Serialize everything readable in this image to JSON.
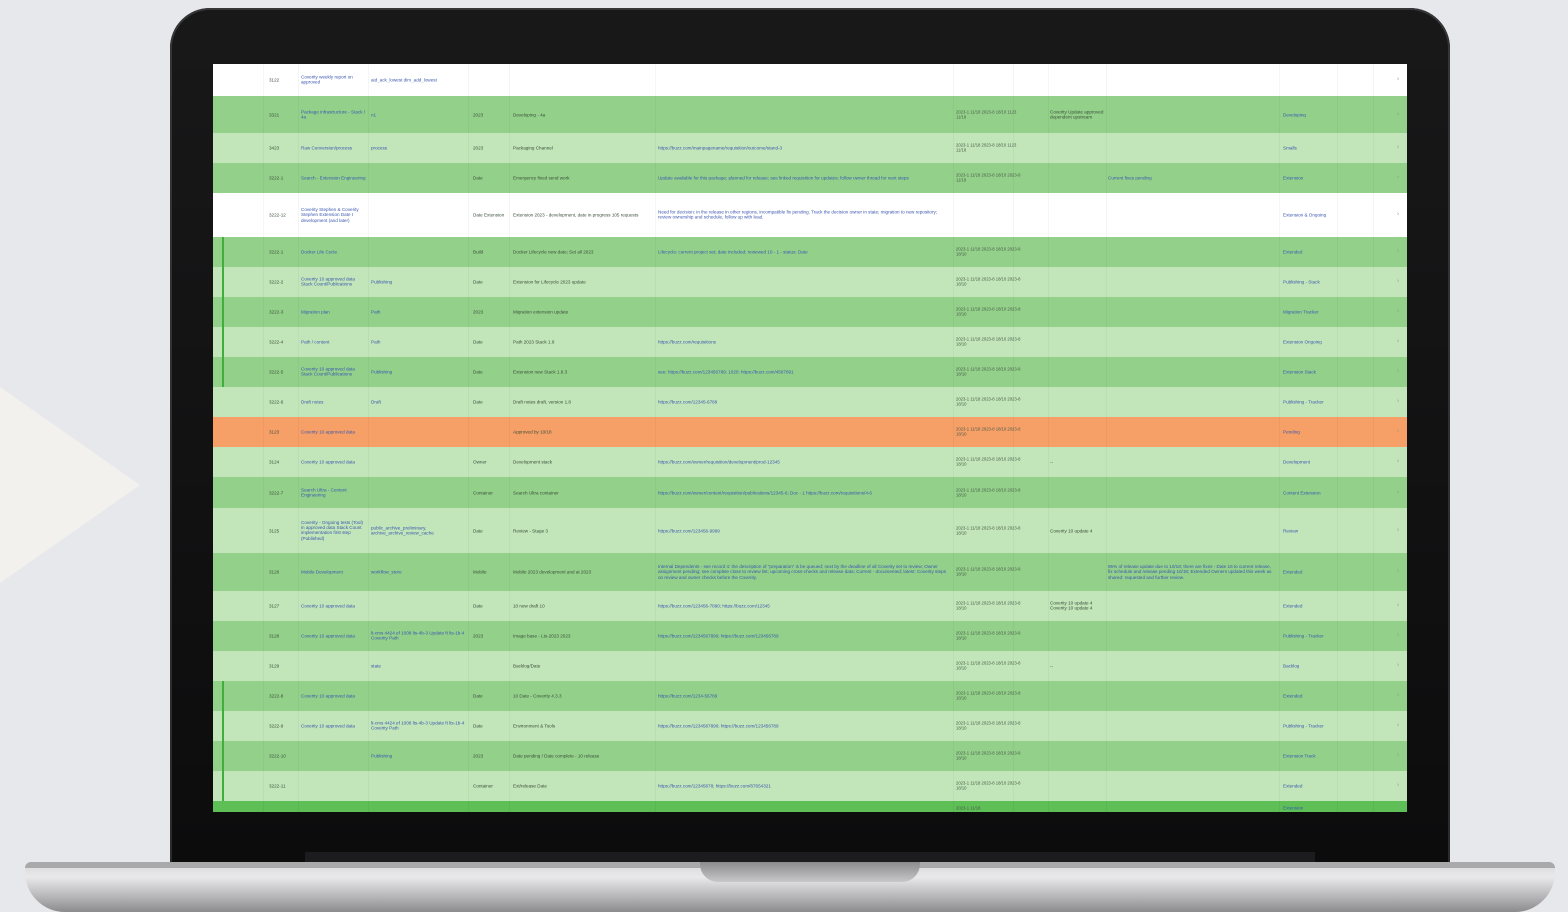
{
  "device": {
    "type": "laptop"
  },
  "sheet": {
    "rows": [
      {
        "style": "white",
        "h": 32,
        "mark": false,
        "cells": {
          "id": "3122",
          "title": "Coverity weekly report on approved",
          "tag": "aid_ack_lowest dim_add_lowest",
          "status": "",
          "summary": "",
          "note": "",
          "dates": "",
          "comment": "",
          "extra": "",
          "owner": ""
        }
      },
      {
        "style": "gd",
        "h": 37,
        "mark": false,
        "cells": {
          "id": "3321",
          "title": "Package infrastructure - Stack / 4a",
          "tag": "n1",
          "status": "2023",
          "summary": "Developing - 4a",
          "note": "",
          "dates": "2023-1 11/18 2023-8 18/10 1123 11/18",
          "comment": "Coverity Update approved dependent upstream",
          "extra": "",
          "owner": "Developing"
        }
      },
      {
        "style": "gl",
        "h": 30,
        "mark": false,
        "cells": {
          "id": "3423",
          "title": "Raw Conversion/process",
          "tag": "process",
          "status": "2023",
          "summary": "Packaging Channel",
          "note": "https://buzz.com/mainpagename/requisition/outcome/stand-3",
          "dates": "2023-1 11/18 2023-8 18/10 1123 11/18",
          "comment": "",
          "extra": "",
          "owner": "Smalls"
        }
      },
      {
        "style": "gd",
        "h": 30,
        "mark": false,
        "cells": {
          "id": "3222-1",
          "title": "Search - Extension Engineering",
          "tag": "",
          "status": "Date",
          "summary": "Emergency fixed send work",
          "note": "Update available for this package; planned for release; see linked requisition for updates; follow owner thread for next steps",
          "dates": "2023-1 11/18 2023-8 18/10 2023-8 11/18",
          "comment": "",
          "extra": "Current fixes pending",
          "owner": "Extension"
        }
      },
      {
        "style": "white",
        "h": 44,
        "mark": false,
        "cells": {
          "id": "3222-12",
          "title": "Coverity Stephen & Coverity Stephen Extension Date I development (and later)",
          "tag": "",
          "status": "Date Extension",
          "summary": "Extension 2023 - development, date in progress 105 requests",
          "note": "Need for decision: in the release in other regions, incompatible fix pending. Track the decision owner in state; migration to new repository; review ownership and schedule, follow up with lead.",
          "dates": "",
          "comment": "",
          "extra": "",
          "owner": "Extension & Ongoing"
        }
      },
      {
        "style": "gd",
        "h": 30,
        "mark": true,
        "cells": {
          "id": "3222-1",
          "title": "Docker Life Cycle",
          "tag": "",
          "status": "Build",
          "summary": "Docker Lifecycle new date; Set all 2023",
          "note": "Lifecycle: current project set; date included; reviewed 10 - 1 - status: Date",
          "dates": "2023-1 11/18 2023-8 18/10 2023-8 18/10",
          "comment": "",
          "extra": "",
          "owner": "Extended"
        }
      },
      {
        "style": "gl",
        "h": 30,
        "mark": true,
        "cells": {
          "id": "3222-2",
          "title": "Coverity 10 approved data Stack Count/Publications",
          "tag": "Publishing",
          "status": "Date",
          "summary": "Extension for Lifecycle 2023 update",
          "note": "",
          "dates": "2023-1 11/18 2023-8 18/10 2023-8 18/10",
          "comment": "",
          "extra": "",
          "owner": "Publishing - Stack"
        }
      },
      {
        "style": "gd",
        "h": 30,
        "mark": true,
        "cells": {
          "id": "3222-3",
          "title": "Migration plan",
          "tag": "Path",
          "status": "2023",
          "summary": "Migration extension update",
          "note": "",
          "dates": "2023-1 11/18 2023-8 18/10 2023-8 18/10",
          "comment": "",
          "extra": "",
          "owner": "Migration Tracker"
        }
      },
      {
        "style": "gl",
        "h": 30,
        "mark": true,
        "cells": {
          "id": "3222-4",
          "title": "Path / content",
          "tag": "Path",
          "status": "Date",
          "summary": "Path 2023 Stack 1.8",
          "note": "https://buzz.com/requisitions",
          "dates": "2023-1 11/18 2023-8 18/10 2023-8 18/10",
          "comment": "",
          "extra": "",
          "owner": "Extension Ongoing"
        }
      },
      {
        "style": "gd",
        "h": 30,
        "mark": true,
        "cells": {
          "id": "3222-5",
          "title": "Coverity 10 approved data Stack Count/Publications",
          "tag": "Publishing",
          "status": "Date",
          "summary": "Extension new Stack 1.8.3",
          "note": "see: https://buzz.com/123456789; 1020: https://buzz.com/4567891",
          "dates": "2023-1 11/18 2023-8 18/10 2023-8 18/10",
          "comment": "",
          "extra": "",
          "owner": "Extension Stack"
        }
      },
      {
        "style": "gl",
        "h": 30,
        "mark": false,
        "cells": {
          "id": "3222-6",
          "title": "Draft notes",
          "tag": "Draft",
          "status": "Date",
          "summary": "Draft notes draft, version 1.8",
          "note": "https://buzz.com/12345-6789",
          "dates": "2023-1 11/18 2023-8 18/10 2023-8 18/10",
          "comment": "",
          "extra": "",
          "owner": "Publishing - Tracker"
        }
      },
      {
        "style": "orange",
        "h": 30,
        "mark": false,
        "cells": {
          "id": "3123",
          "title": "Coverity 10 approved data",
          "tag": "",
          "status": "",
          "summary": "Approved by 10/18",
          "note": "",
          "dates": "2023-1 11/18 2023-8 18/10 2023-8 18/10",
          "comment": "",
          "extra": "",
          "owner": "Pending"
        }
      },
      {
        "style": "gl",
        "h": 30,
        "mark": false,
        "cells": {
          "id": "3124",
          "title": "Coverity 10 approved data",
          "tag": "",
          "status": "Owner",
          "summary": "Development stack",
          "note": "https://buzz.com/owner/requisition/development/prod-12345",
          "dates": "2023-1 11/18 2023-8 18/10 2023-8 18/10",
          "comment": "--",
          "extra": "",
          "owner": "Development"
        }
      },
      {
        "style": "gd",
        "h": 31,
        "mark": false,
        "cells": {
          "id": "3222-7",
          "title": "Search Ultra - Content Engineering",
          "tag": "",
          "status": "Container",
          "summary": "Search Ultra container",
          "note": "https://buzz.com/owner/content/requisition/publications/12345-6; Doc - 1 https://buzz.com/requisitions/4-6",
          "dates": "2023-1 11/18 2023-8 18/10 2023-8 18/10",
          "comment": "",
          "extra": "",
          "owner": "Content Extension"
        }
      },
      {
        "style": "gl",
        "h": 45,
        "mark": false,
        "cells": {
          "id": "3125",
          "title": "Coverity - Ongoing tests (Tool) in approved data Stack Count implementation first step (Published)",
          "tag": "public_archive_preliminary, archive_archive_review_cache",
          "status": "Date",
          "summary": "Review - Stage 3",
          "note": "https://buzz.com/123456-9999",
          "dates": "2023-1 11/18 2023-8 18/10 2023-8 18/10",
          "comment": "Coverity 10 update 4",
          "extra": "",
          "owner": "Review"
        }
      },
      {
        "style": "gd",
        "h": 38,
        "mark": false,
        "cells": {
          "id": "3126",
          "title": "Mobile Development",
          "tag": "workflow_store",
          "status": "Mobile",
          "summary": "Mobile 2023 development and at 2023",
          "note": "Internal Dependents - see record 4: the description of \"preparation\" is be queued; next by the deadline of all Coverity set to review; Owner assignment pending; see complete close to review list; upcoming cross-checks and release data; Current - documented; latest: Coverity steps on review and owner checks before the Coverity.",
          "dates": "2023-1 11/18 2023-8 18/10 2023-8 18/10",
          "comment": "",
          "extra": "95% of release update due to 10/18; there are fixes - Date 16 to current release, fix schedule and release pending 10/18; Extended Owners updated this week as shared: requested and further review.",
          "owner": "Extended"
        }
      },
      {
        "style": "gl",
        "h": 30,
        "mark": false,
        "cells": {
          "id": "3127",
          "title": "Coverity 10 approved data",
          "tag": "",
          "status": "Date",
          "summary": "10 new draft 10",
          "note": "https://buzz.com/123456-7890; https://buzz.com/12345",
          "dates": "2023-1 11/18 2023-8 18/10 2023-8 18/10",
          "comment": "Coverity 10 update 4 Coverity 10 update 4",
          "extra": "",
          "owner": "Extended"
        }
      },
      {
        "style": "gd",
        "h": 30,
        "mark": false,
        "cells": {
          "id": "3128",
          "title": "Coverity 10 approved data",
          "tag": "lt-cms 4424 ef 1008 lts-4b-3 Update ft lts-1b-4 Coverity Path",
          "status": "2023",
          "summary": "Image base - Lts-2023 2023",
          "note": "https://buzz.com/1234567890; https://buzz.com/123456789",
          "dates": "2023-1 11/18 2023-8 18/10 2023-8 18/10",
          "comment": "",
          "extra": "",
          "owner": "Publishing - Tracker"
        }
      },
      {
        "style": "gl",
        "h": 30,
        "mark": false,
        "cells": {
          "id": "3129",
          "title": "",
          "tag": "state",
          "status": "",
          "summary": "Backlog/Date",
          "note": "",
          "dates": "2023-1 11/18 2023-8 18/10 2023-8 18/10",
          "comment": "--",
          "extra": "",
          "owner": "Backlog"
        }
      },
      {
        "style": "gd",
        "h": 30,
        "mark": true,
        "cells": {
          "id": "3222-8",
          "title": "Coverity 10 approved data",
          "tag": "",
          "status": "Date",
          "summary": "10 Date - Coverity 4.3.3",
          "note": "https://buzz.com/1234-56789",
          "dates": "2023-1 11/18 2023-8 18/10 2023-8 18/10",
          "comment": "",
          "extra": "",
          "owner": "Extended"
        }
      },
      {
        "style": "gl",
        "h": 30,
        "mark": true,
        "cells": {
          "id": "3222-9",
          "title": "Coverity 10 approved data",
          "tag": "lt-cms 4424 ef 1008 lts-4b-3 Update ft lts-1b-4 Coverity Path",
          "status": "Date",
          "summary": "Environment & Tools",
          "note": "https://buzz.com/1234567890; https://buzz.com/123456789",
          "dates": "2023-1 11/18 2023-8 18/10 2023-8 18/10",
          "comment": "",
          "extra": "",
          "owner": "Publishing - Tracker"
        }
      },
      {
        "style": "gd",
        "h": 30,
        "mark": true,
        "cells": {
          "id": "3222-10",
          "title": "",
          "tag": "Publishing",
          "status": "2023",
          "summary": "Date pending / Date complete - 10 release",
          "note": "",
          "dates": "2023-1 11/18 2023-8 18/10 2023-8 18/10",
          "comment": "",
          "extra": "",
          "owner": "Extension Track"
        }
      },
      {
        "style": "gl",
        "h": 30,
        "mark": true,
        "cells": {
          "id": "3222-11",
          "title": "",
          "tag": "",
          "status": "Container",
          "summary": "Ext/release Date",
          "note": "https://buzz.com/12345678; https://buzz.com/87654321",
          "dates": "2023-1 11/18 2023-8 18/10 2023-8 18/10",
          "comment": "",
          "extra": "",
          "owner": "Extended"
        }
      },
      {
        "style": "bright",
        "h": 14,
        "mark": false,
        "cells": {
          "id": "",
          "title": "",
          "tag": "",
          "status": "",
          "summary": "",
          "note": "",
          "dates": "2023-1 11/18",
          "comment": "",
          "extra": "",
          "owner": "Extension"
        }
      }
    ]
  }
}
